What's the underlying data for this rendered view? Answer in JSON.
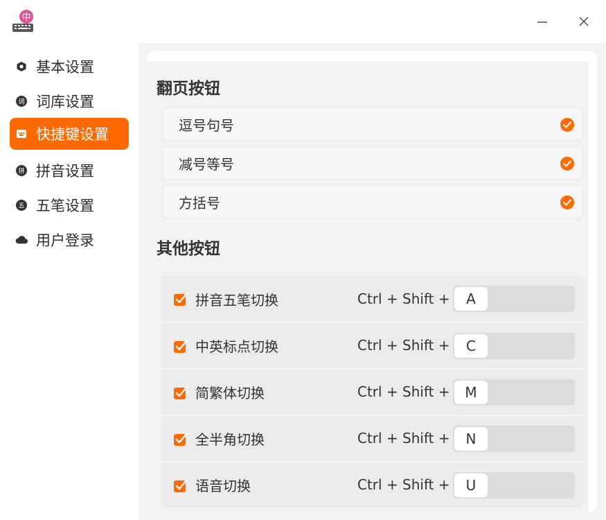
{
  "titlebar": {
    "app_icon_char": "中",
    "minimize_glyph": "—",
    "close_glyph": "✕"
  },
  "sidebar": {
    "items": [
      {
        "label": "基本设置",
        "icon": "hexagon-icon",
        "active": false
      },
      {
        "label": "词库设置",
        "icon": "dict-icon",
        "icon_char": "词",
        "active": false
      },
      {
        "label": "快捷键设置",
        "icon": "keyboard-icon",
        "active": true
      },
      {
        "label": "拼音设置",
        "icon": "pinyin-icon",
        "icon_char": "拼",
        "active": false
      },
      {
        "label": "五笔设置",
        "icon": "wubi-icon",
        "icon_char": "五",
        "active": false
      },
      {
        "label": "用户登录",
        "icon": "cloud-icon",
        "active": false
      }
    ]
  },
  "page_buttons": {
    "title": "翻页按钮",
    "items": [
      {
        "label": "逗号句号",
        "checked": true
      },
      {
        "label": "减号等号",
        "checked": true
      },
      {
        "label": "方括号",
        "checked": true
      }
    ]
  },
  "other_buttons": {
    "title": "其他按钮",
    "items": [
      {
        "label": "拼音五笔切换",
        "checked": true,
        "combo": "Ctrl + Shift +",
        "key": "A"
      },
      {
        "label": "中英标点切换",
        "checked": true,
        "combo": "Ctrl + Shift +",
        "key": "C"
      },
      {
        "label": "简繁体切换",
        "checked": true,
        "combo": "Ctrl + Shift +",
        "key": "M"
      },
      {
        "label": "全半角切换",
        "checked": true,
        "combo": "Ctrl + Shift +",
        "key": "N"
      },
      {
        "label": "语音切换",
        "checked": true,
        "combo": "Ctrl + Shift +",
        "key": "U"
      }
    ]
  },
  "colors": {
    "accent": "#ff6a00",
    "panel_bg": "#f2f2f2",
    "white": "#ffffff"
  }
}
